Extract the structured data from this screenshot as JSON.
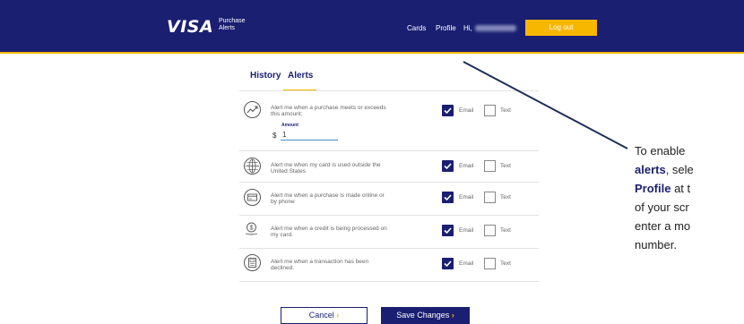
{
  "header": {
    "logo": "VISA",
    "logo_sub": "Purchase Alerts",
    "nav_cards": "Cards",
    "nav_profile": "Profile",
    "nav_greeting": "Hi,",
    "logout": "Log out"
  },
  "tabs": [
    {
      "label": "History"
    },
    {
      "label": "Alerts"
    }
  ],
  "amount": {
    "label": "Amount",
    "currency": "$",
    "value": "1"
  },
  "channel_labels": {
    "email": "Email",
    "text": "Text"
  },
  "alerts": [
    {
      "icon": "trending-up-icon",
      "text": "Alert me when a purchase meets or exceeds this amount:",
      "email": true,
      "text_msg": false
    },
    {
      "icon": "globe-icon",
      "text": "Alert me when my card is used outside the United States",
      "email": true,
      "text_msg": false
    },
    {
      "icon": "card-online-icon",
      "text": "Alert me when a purchase is made online or by phone",
      "email": true,
      "text_msg": false
    },
    {
      "icon": "dollar-hand-icon",
      "text": "Alert me when a credit is being processed on my card.",
      "email": true,
      "text_msg": false
    },
    {
      "icon": "declined-terminal-icon",
      "text": "Alert me when a transaction has been declined.",
      "email": true,
      "text_msg": false
    }
  ],
  "buttons": {
    "cancel": "Cancel",
    "save": "Save Changes",
    "chevron": "›"
  },
  "callout": {
    "line1": "To enable",
    "line2_bold": "alerts",
    "line2_rest": ", sele",
    "line3_bold": "Profile",
    "line3_rest": " at t",
    "line4": "of your scr",
    "line5": "enter a mo",
    "line6": "number."
  },
  "colors": {
    "brand_navy": "#1a1f71",
    "accent_gold": "#f7b600"
  }
}
